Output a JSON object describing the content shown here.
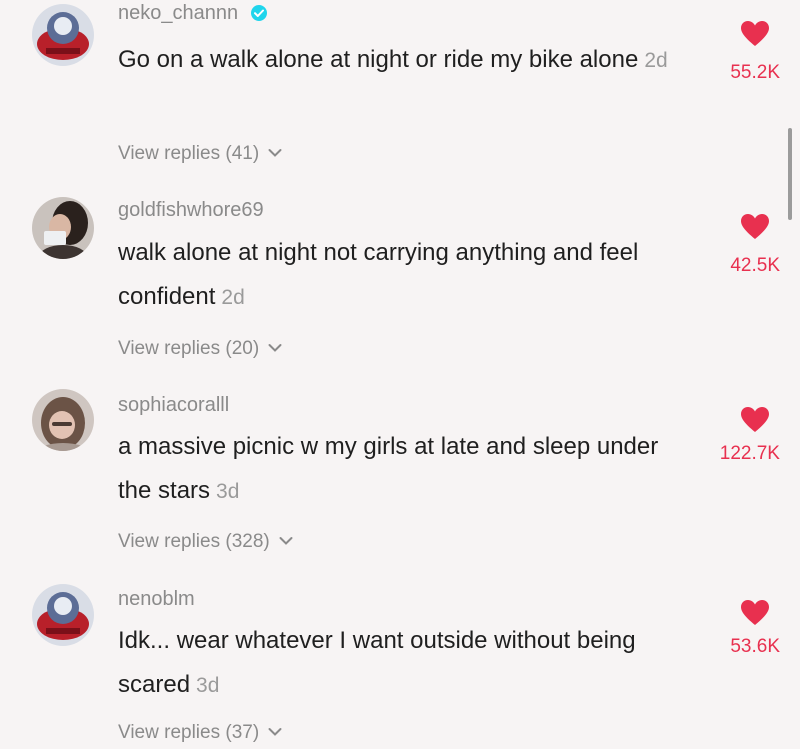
{
  "colors": {
    "background": "#f7f4f4",
    "like": "#e8304f",
    "verified": "#20d5ec"
  },
  "comments": [
    {
      "username": "neko_channn",
      "verified": true,
      "text": "Go on a walk alone at night or ride my bike alone",
      "age": "2d",
      "replies": "View replies (41)",
      "likes": "55.2K"
    },
    {
      "username": "goldfishwhore69",
      "verified": false,
      "text": "walk alone at night not carrying anything and feel confident",
      "age": "2d",
      "replies": "View replies (20)",
      "likes": "42.5K"
    },
    {
      "username": "sophiacoralll",
      "verified": false,
      "text": "a massive picnic w my girls at late and sleep under the stars",
      "age": "3d",
      "replies": "View replies (328)",
      "likes": "122.7K"
    },
    {
      "username": "nenoblm",
      "verified": false,
      "text": "Idk... wear whatever I want outside without being scared",
      "age": "3d",
      "replies": "View replies (37)",
      "likes": "53.6K"
    }
  ]
}
